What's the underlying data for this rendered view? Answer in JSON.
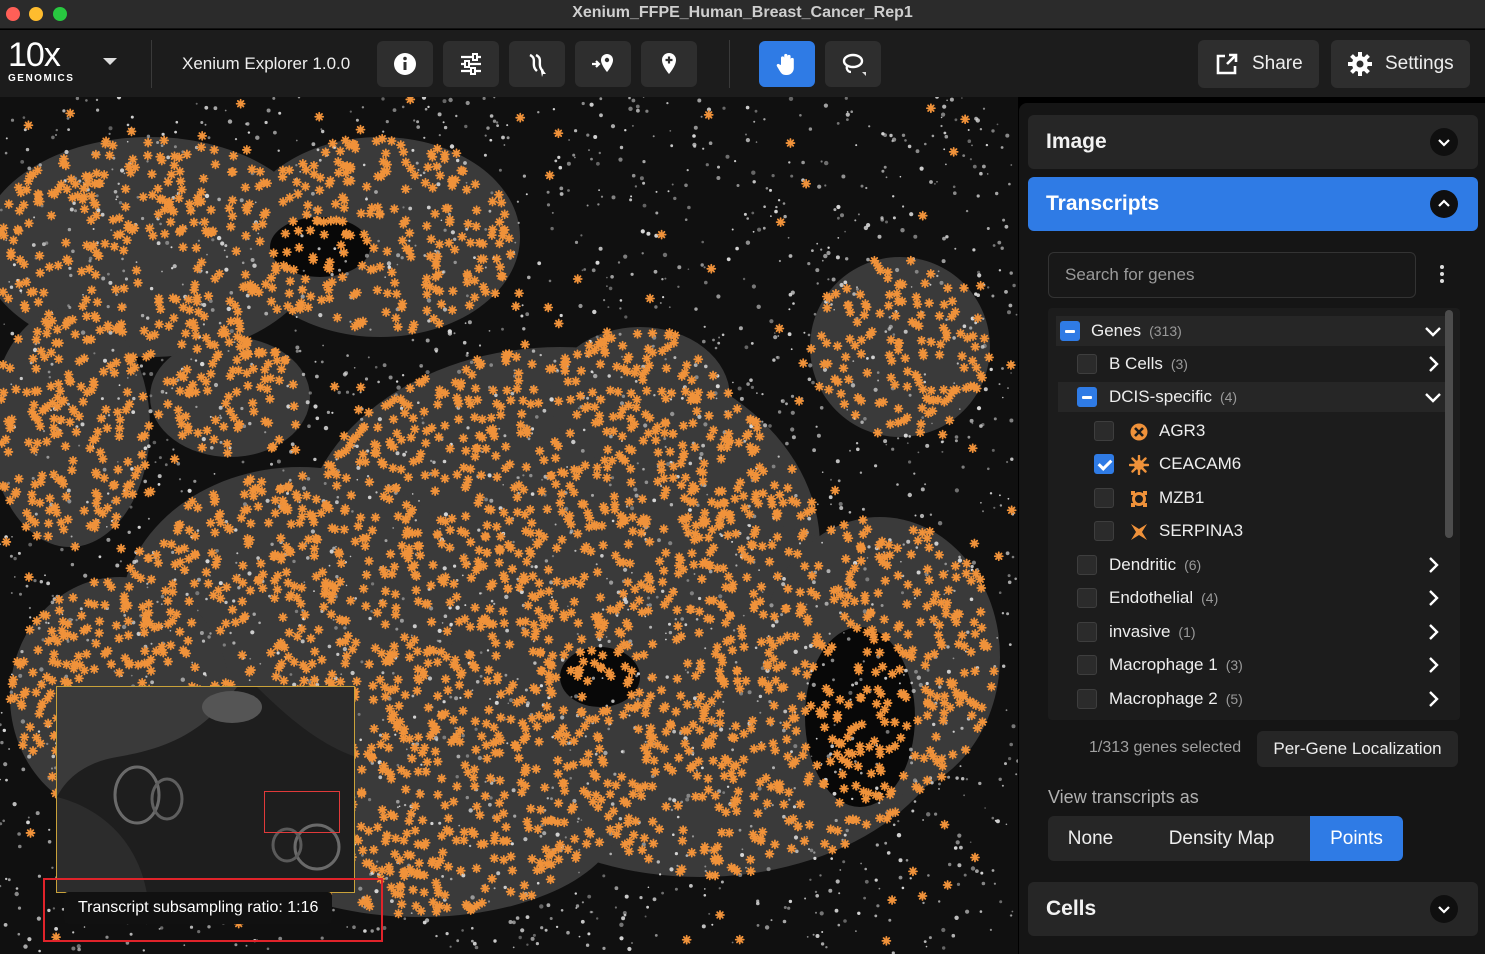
{
  "window": {
    "title": "Xenium_FFPE_Human_Breast_Cancer_Rep1"
  },
  "toolbar": {
    "logo_main": "10x",
    "logo_sub": "GENOMICS",
    "app_name": "Xenium Explorer 1.0.0",
    "share_label": "Share",
    "settings_label": "Settings"
  },
  "canvas": {
    "tooltip": "Transcript subsampling ratio: 1:16"
  },
  "panel": {
    "image_header": "Image",
    "transcripts_header": "Transcripts",
    "cells_header": "Cells",
    "search_placeholder": "Search for genes",
    "genes_selected": "1/313 genes selected",
    "per_gene_button": "Per-Gene Localization",
    "view_as_label": "View transcripts as",
    "view_options": [
      "None",
      "Density Map",
      "Points"
    ],
    "view_selected": "Points"
  },
  "gene_tree": {
    "root": {
      "label": "Genes",
      "count": "(313)",
      "state": "partial"
    },
    "groups": [
      {
        "label": "B Cells",
        "count": "(3)",
        "state": "unchecked"
      },
      {
        "label": "DCIS-specific",
        "count": "(4)",
        "state": "partial"
      },
      {
        "label": "Dendritic",
        "count": "(6)",
        "state": "unchecked"
      },
      {
        "label": "Endothelial",
        "count": "(4)",
        "state": "unchecked"
      },
      {
        "label": "invasive",
        "count": "(1)",
        "state": "unchecked"
      },
      {
        "label": "Macrophage 1",
        "count": "(3)",
        "state": "unchecked"
      },
      {
        "label": "Macrophage 2",
        "count": "(5)",
        "state": "unchecked"
      }
    ],
    "dcis_genes": [
      {
        "label": "AGR3",
        "icon": "x-circle-glyph-icon",
        "state": "unchecked"
      },
      {
        "label": "CEACAM6",
        "icon": "starburst-glyph-icon",
        "state": "checked"
      },
      {
        "label": "MZB1",
        "icon": "ring-glyph-icon",
        "state": "unchecked"
      },
      {
        "label": "SERPINA3",
        "icon": "x-mark-glyph-icon",
        "state": "unchecked"
      }
    ]
  },
  "colors": {
    "accent": "#2f7be5",
    "transcript_point": "#f0923a",
    "minimap_border": "#c9a23a",
    "minimap_viewport": "#e03a3a",
    "highlight_frame": "#e0232a"
  }
}
